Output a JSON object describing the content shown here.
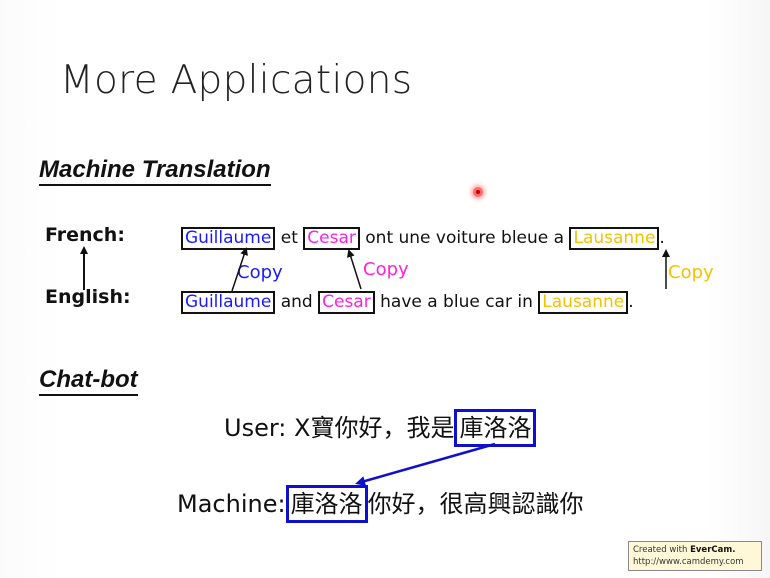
{
  "title": "More Applications",
  "machine_translation": {
    "heading": "Machine Translation",
    "french_label": "French:",
    "english_label": "English:",
    "french_words": [
      "Guillaume",
      "et",
      "Cesar",
      "ont une voiture bleue a",
      "Lausanne",
      "."
    ],
    "english_words": [
      "Guillaume",
      "and",
      "Cesar",
      "have a blue car in",
      "Lausanne",
      "."
    ],
    "copy_labels": [
      "Copy",
      "Copy",
      "Copy"
    ],
    "colors": {
      "name1": "#1a1aff",
      "name2": "#ff22dd",
      "place": "#f2c200"
    }
  },
  "chatbot": {
    "heading": "Chat-bot",
    "user_label": "User:",
    "user_prefix": "X寶你好，我是",
    "user_name": "庫洛洛",
    "machine_label": "Machine:",
    "machine_name": "庫洛洛",
    "machine_suffix": "你好，很高興認識你",
    "box_color": "#1010cc"
  },
  "watermark": {
    "line1_prefix": "Created with ",
    "line1_brand": "EverCam.",
    "line2": "http://www.camdemy.com"
  }
}
